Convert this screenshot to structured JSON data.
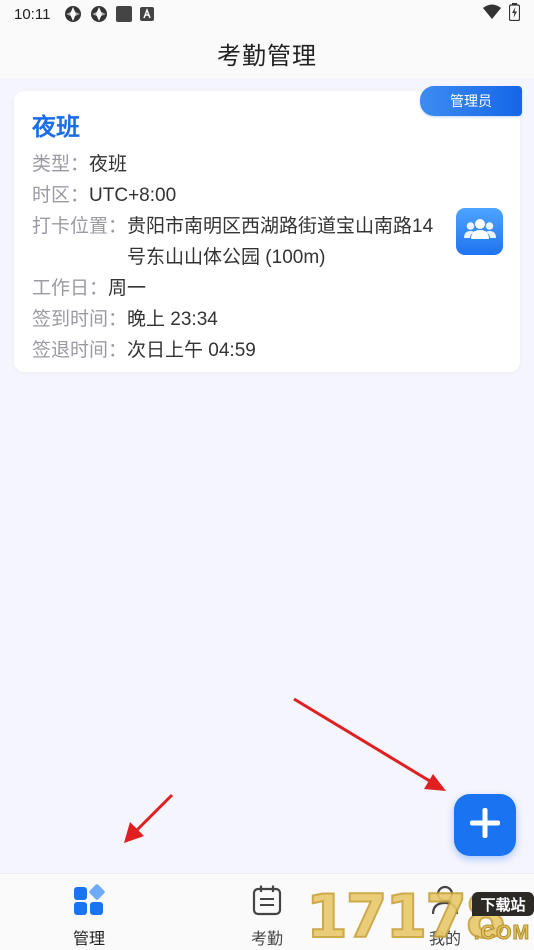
{
  "status_bar": {
    "time": "10:11",
    "left_icons": [
      "sync-icon",
      "sync-icon",
      "square-icon",
      "a-notification-icon"
    ],
    "right_icons": [
      "wifi-icon",
      "battery-charging-icon"
    ]
  },
  "app_bar": {
    "title": "考勤管理"
  },
  "card": {
    "title": "夜班",
    "badge": "管理员",
    "rows": [
      {
        "label": "类型：",
        "value": "夜班"
      },
      {
        "label": "时区：",
        "value": "UTC+8:00"
      },
      {
        "label": "打卡位置：",
        "value": "贵阳市南明区西湖路街道宝山南路14号东山山体公园 (100m)"
      },
      {
        "label": "工作日：",
        "value": "周一"
      },
      {
        "label": "签到时间：",
        "value": "晚上 23:34"
      },
      {
        "label": "签退时间：",
        "value": "次日上午 04:59"
      }
    ],
    "side_button_icon": "group-users-icon"
  },
  "fab": {
    "icon": "plus-icon"
  },
  "bottom_nav": {
    "items": [
      {
        "label": "管理",
        "icon": "manage-grid-icon",
        "active": true
      },
      {
        "label": "考勤",
        "icon": "calendar-icon",
        "active": false
      },
      {
        "label": "我的",
        "icon": "profile-icon",
        "active": false
      }
    ]
  },
  "watermark": {
    "digits": "17178",
    "tag": "下载站",
    "domain": ".COM"
  },
  "colors": {
    "accent": "#1a73f0",
    "title_blue": "#1a6ce8",
    "background": "#f5f5fd",
    "annotation_arrow": "#e02020"
  }
}
